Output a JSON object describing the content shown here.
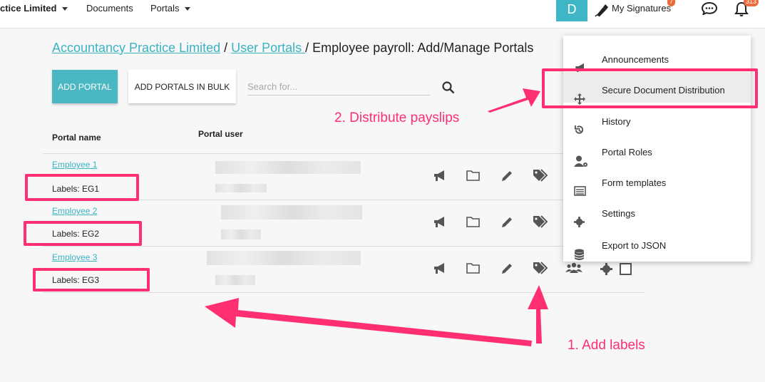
{
  "topbar": {
    "company_menu": "ctice Limited",
    "documents": "Documents",
    "portals": "Portals",
    "avatar_initial": "D",
    "my_signatures": "My Signatures",
    "signatures_badge": "7",
    "notifications_badge": "313"
  },
  "breadcrumb": {
    "crumb1": "Accountancy Practice Limited",
    "sep1": " / ",
    "crumb2": "User Portals ",
    "sep2": " / ",
    "current": "Employee payroll: Add/Manage Portals"
  },
  "toolbar": {
    "add_portal": "ADD PORTAL",
    "add_bulk": "ADD PORTALS IN BULK",
    "search_placeholder": "Search for..."
  },
  "table": {
    "headers": [
      "Portal name",
      "Portal user"
    ],
    "rows": [
      {
        "name": "Employee 1",
        "labels": "Labels: EG1"
      },
      {
        "name": "Employee 2",
        "labels": "Labels: EG2"
      },
      {
        "name": "Employee 3",
        "labels": "Labels: EG3"
      }
    ]
  },
  "menu": {
    "items": [
      {
        "label": "Announcements",
        "icon": "megaphone-icon"
      },
      {
        "label": "Secure Document Distribution",
        "icon": "move-arrows-icon"
      },
      {
        "label": "History",
        "icon": "history-icon"
      },
      {
        "label": "Portal Roles",
        "icon": "user-cog-icon"
      },
      {
        "label": "Form templates",
        "icon": "form-icon"
      },
      {
        "label": "Settings",
        "icon": "gear-icon"
      },
      {
        "label": "Export to JSON",
        "icon": "database-icon"
      }
    ]
  },
  "annotations": {
    "step1": "1. Add labels",
    "step2": "2. Distribute payslips"
  },
  "colors": {
    "accent": "#3bb3c3",
    "annotation": "#ff2f72",
    "badge": "#ee6a3c"
  }
}
